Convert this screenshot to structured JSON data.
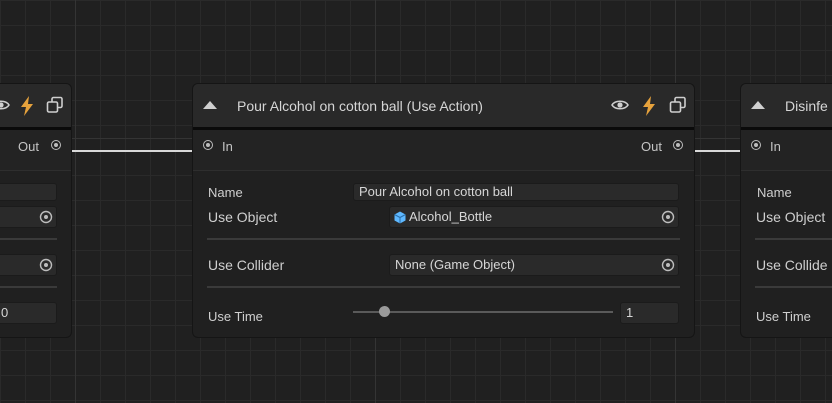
{
  "colors": {
    "background": "#202020",
    "node_body": "#202020",
    "node_header": "#292929",
    "field": "#2a2a2a",
    "edge": "#d8d8d8",
    "lightning": "#e6a23c",
    "object_icon": "#5eb8ff"
  },
  "icons": [
    "collapse-triangle-icon",
    "eye-icon",
    "lightning-icon",
    "copy-icon",
    "object-picker-icon",
    "cube-icon",
    "port-icon"
  ],
  "left_node": {
    "out_label": "Out",
    "field_value": "0"
  },
  "center_node": {
    "title": "Pour Alcohol on cotton ball (Use Action)",
    "in_label": "In",
    "out_label": "Out",
    "name_label": "Name",
    "name_value": "Pour Alcohol on cotton ball",
    "use_object_label": "Use Object",
    "use_object_value": "Alcohol_Bottle",
    "use_collider_label": "Use Collider",
    "use_collider_value": "None (Game Object)",
    "use_time_label": "Use Time",
    "use_time_value": "1",
    "use_time_slider_fraction": 0.12
  },
  "right_node": {
    "title": "Disinfe",
    "in_label": "In",
    "name_label": "Name",
    "use_object_label": "Use Object",
    "use_collider_label": "Use Collide",
    "use_time_label": "Use Time"
  }
}
